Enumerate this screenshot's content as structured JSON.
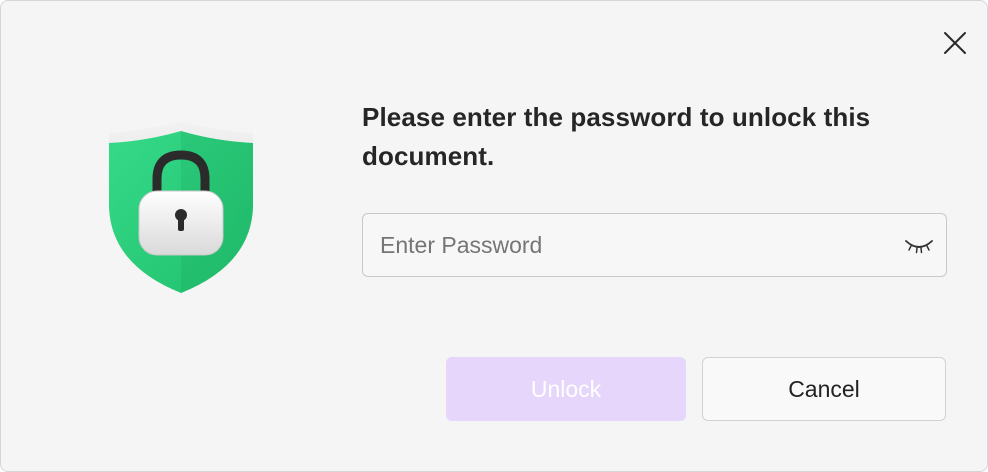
{
  "dialog": {
    "message": "Please enter the password to unlock this document.",
    "illustration_icon": "shield-lock-icon",
    "close_icon": "close-icon"
  },
  "password_field": {
    "placeholder": "Enter Password",
    "value": "",
    "visibility_icon": "eye-closed-icon"
  },
  "buttons": {
    "unlock_label": "Unlock",
    "cancel_label": "Cancel"
  },
  "colors": {
    "shield_green": "#2fd17f",
    "unlock_disabled_bg": "#e6d6fb",
    "background": "#f5f5f5"
  }
}
